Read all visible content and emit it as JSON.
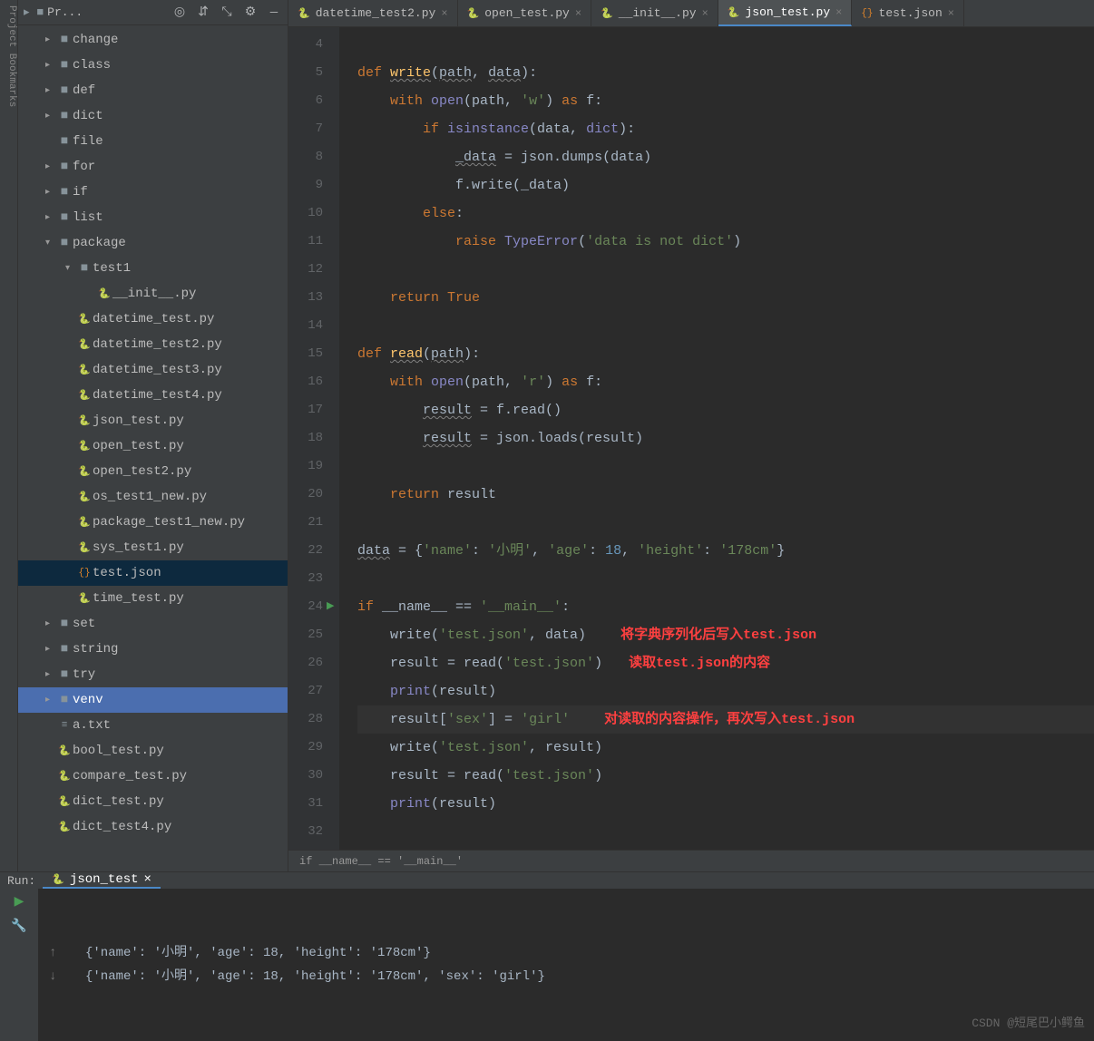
{
  "sidebar": {
    "title": "Pr...",
    "items": [
      {
        "label": "change",
        "depth": 1,
        "arrow": "▸",
        "icon": "folder"
      },
      {
        "label": "class",
        "depth": 1,
        "arrow": "▸",
        "icon": "folder"
      },
      {
        "label": "def",
        "depth": 1,
        "arrow": "▸",
        "icon": "folder"
      },
      {
        "label": "dict",
        "depth": 1,
        "arrow": "▸",
        "icon": "folder"
      },
      {
        "label": "file",
        "depth": 1,
        "arrow": "",
        "icon": "folder"
      },
      {
        "label": "for",
        "depth": 1,
        "arrow": "▸",
        "icon": "folder"
      },
      {
        "label": "if",
        "depth": 1,
        "arrow": "▸",
        "icon": "folder"
      },
      {
        "label": "list",
        "depth": 1,
        "arrow": "▸",
        "icon": "folder"
      },
      {
        "label": "package",
        "depth": 1,
        "arrow": "▾",
        "icon": "folder"
      },
      {
        "label": "test1",
        "depth": 2,
        "arrow": "▾",
        "icon": "folder"
      },
      {
        "label": "__init__.py",
        "depth": 3,
        "arrow": "",
        "icon": "py"
      },
      {
        "label": "datetime_test.py",
        "depth": 2,
        "arrow": "",
        "icon": "py"
      },
      {
        "label": "datetime_test2.py",
        "depth": 2,
        "arrow": "",
        "icon": "py"
      },
      {
        "label": "datetime_test3.py",
        "depth": 2,
        "arrow": "",
        "icon": "py"
      },
      {
        "label": "datetime_test4.py",
        "depth": 2,
        "arrow": "",
        "icon": "py"
      },
      {
        "label": "json_test.py",
        "depth": 2,
        "arrow": "",
        "icon": "py"
      },
      {
        "label": "open_test.py",
        "depth": 2,
        "arrow": "",
        "icon": "py"
      },
      {
        "label": "open_test2.py",
        "depth": 2,
        "arrow": "",
        "icon": "py"
      },
      {
        "label": "os_test1_new.py",
        "depth": 2,
        "arrow": "",
        "icon": "py"
      },
      {
        "label": "package_test1_new.py",
        "depth": 2,
        "arrow": "",
        "icon": "py"
      },
      {
        "label": "sys_test1.py",
        "depth": 2,
        "arrow": "",
        "icon": "py"
      },
      {
        "label": "test.json",
        "depth": 2,
        "arrow": "",
        "icon": "json",
        "selected": true
      },
      {
        "label": "time_test.py",
        "depth": 2,
        "arrow": "",
        "icon": "py"
      },
      {
        "label": "set",
        "depth": 1,
        "arrow": "▸",
        "icon": "folder"
      },
      {
        "label": "string",
        "depth": 1,
        "arrow": "▸",
        "icon": "folder"
      },
      {
        "label": "try",
        "depth": 1,
        "arrow": "▸",
        "icon": "folder"
      },
      {
        "label": "venv",
        "depth": 1,
        "arrow": "▸",
        "icon": "folder",
        "highlighted": true
      },
      {
        "label": "a.txt",
        "depth": 1,
        "arrow": "",
        "icon": "txt"
      },
      {
        "label": "bool_test.py",
        "depth": 1,
        "arrow": "",
        "icon": "py"
      },
      {
        "label": "compare_test.py",
        "depth": 1,
        "arrow": "",
        "icon": "py"
      },
      {
        "label": "dict_test.py",
        "depth": 1,
        "arrow": "",
        "icon": "py"
      },
      {
        "label": "dict_test4.py",
        "depth": 1,
        "arrow": "",
        "icon": "py"
      }
    ]
  },
  "tabs": [
    {
      "label": "datetime_test2.py",
      "icon": "py"
    },
    {
      "label": "open_test.py",
      "icon": "py"
    },
    {
      "label": "__init__.py",
      "icon": "py"
    },
    {
      "label": "json_test.py",
      "icon": "py",
      "active": true
    },
    {
      "label": "test.json",
      "icon": "json"
    }
  ],
  "gutter_start": 4,
  "gutter_end": 32,
  "run_marker_line": 24,
  "current_line": 28,
  "code_lines": [
    {
      "n": 4,
      "html": ""
    },
    {
      "n": 5,
      "html": "<span class='kw'>def </span><span class='fn wavy'>write</span>(<span class='wavy'>path</span>, <span class='wavy'>data</span>):"
    },
    {
      "n": 6,
      "html": "    <span class='kw'>with </span><span class='bi'>open</span>(path, <span class='str'>'w'</span>) <span class='kw'>as</span> f:"
    },
    {
      "n": 7,
      "html": "        <span class='kw'>if </span><span class='bi'>isinstance</span>(data, <span class='bi'>dict</span>):"
    },
    {
      "n": 8,
      "html": "            <span class='wavy'>_data</span> = json.dumps(data)"
    },
    {
      "n": 9,
      "html": "            f.write(_data)"
    },
    {
      "n": 10,
      "html": "        <span class='kw'>else</span>:"
    },
    {
      "n": 11,
      "html": "            <span class='kw'>raise </span><span class='bi'>TypeError</span>(<span class='str'>'data is not dict'</span>)"
    },
    {
      "n": 12,
      "html": ""
    },
    {
      "n": 13,
      "html": "    <span class='kw'>return </span><span class='kw'>True</span>"
    },
    {
      "n": 14,
      "html": ""
    },
    {
      "n": 15,
      "html": "<span class='kw'>def </span><span class='fn wavy'>read</span>(<span class='wavy'>path</span>):"
    },
    {
      "n": 16,
      "html": "    <span class='kw'>with </span><span class='bi'>open</span>(path, <span class='str'>'r'</span>) <span class='kw'>as</span> f:"
    },
    {
      "n": 17,
      "html": "        <span class='wavy'>result</span> = f.read()"
    },
    {
      "n": 18,
      "html": "        <span class='wavy'>result</span> = json.loads(result)"
    },
    {
      "n": 19,
      "html": ""
    },
    {
      "n": 20,
      "html": "    <span class='kw'>return </span>result"
    },
    {
      "n": 21,
      "html": ""
    },
    {
      "n": 22,
      "html": "<span class='wavy'>data</span> = {<span class='str'>'name'</span>: <span class='str'>'小明'</span>, <span class='str'>'age'</span>: <span class='num'>18</span>, <span class='str'>'height'</span>: <span class='str'>'178cm'</span>}"
    },
    {
      "n": 23,
      "html": ""
    },
    {
      "n": 24,
      "html": "<span class='kw'>if </span>__name__ == <span class='str'>'__main__'</span>:"
    },
    {
      "n": 25,
      "html": "    write(<span class='str'>'test.json'</span>, data)  <span class='note'>将字典序列化后写入test.json</span>"
    },
    {
      "n": 26,
      "html": "    result = read(<span class='str'>'test.json'</span>) <span class='note'>读取test.json的内容</span>"
    },
    {
      "n": 27,
      "html": "    <span class='bi'>print</span>(result)"
    },
    {
      "n": 28,
      "html": "    result[<span class='str'>'sex'</span>] = <span class='str'>'girl'</span>  <span class='note'>对读取的内容操作，再次写入test.json</span>"
    },
    {
      "n": 29,
      "html": "    write(<span class='str'>'test.json'</span>, result)"
    },
    {
      "n": 30,
      "html": "    result = read(<span class='str'>'test.json'</span>)"
    },
    {
      "n": 31,
      "html": "    <span class='bi'>print</span>(result)"
    },
    {
      "n": 32,
      "html": ""
    }
  ],
  "breadcrumb": "if __name__ == '__main__'",
  "run": {
    "label": "Run:",
    "tab": "json_test",
    "lines": [
      "{'name': '小明', 'age': 18, 'height': '178cm'}",
      "{'name': '小明', 'age': 18, 'height': '178cm', 'sex': 'girl'}"
    ]
  },
  "watermark": "CSDN @短尾巴小鳄鱼"
}
